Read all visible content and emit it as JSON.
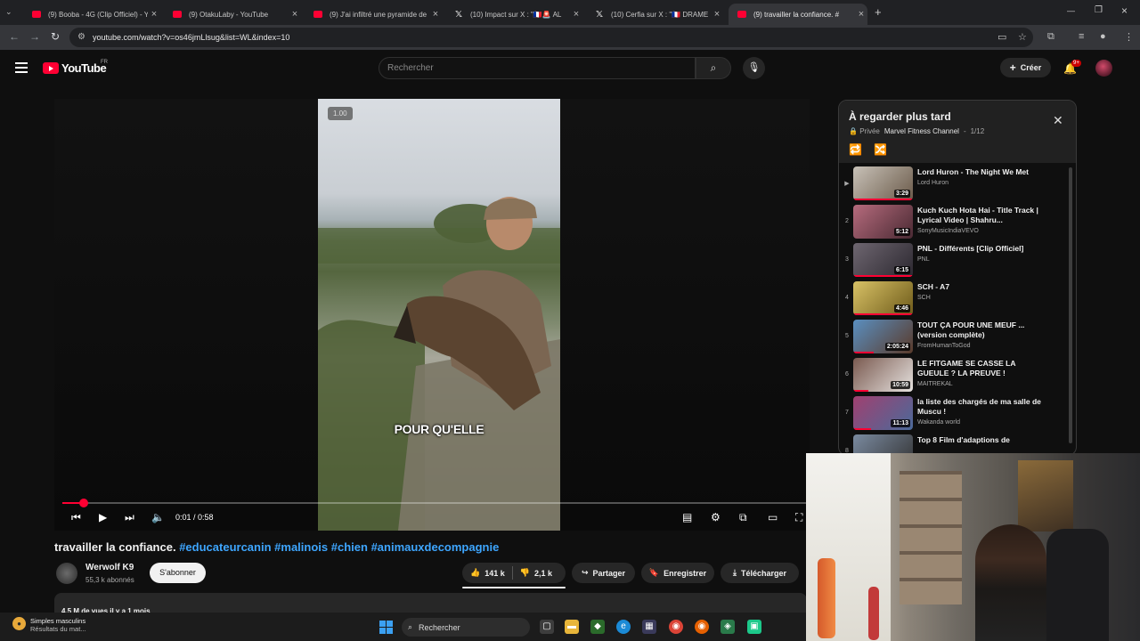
{
  "browser": {
    "tabs": [
      {
        "label": "(9) Booba - 4G (Clip Officiel) - Y",
        "favicon": "youtube-icon"
      },
      {
        "label": "(9) OtakuLaby - YouTube",
        "favicon": "youtube-icon"
      },
      {
        "label": "(9) J'ai infiltré une pyramide de",
        "favicon": "youtube-icon"
      },
      {
        "label": "(10) Impact sur X : \"🇫🇷🚨 AL",
        "favicon": "x-icon"
      },
      {
        "label": "(10) Cerfia sur X : \"🇫🇷 DRAME |",
        "favicon": "x-icon"
      },
      {
        "label": "(9) travailler la confiance. #",
        "favicon": "youtube-icon",
        "active": true
      }
    ],
    "url": "youtube.com/watch?v=os46jmLlsug&list=WL&index=10"
  },
  "header": {
    "logo_text": "YouTube",
    "country": "FR",
    "search_placeholder": "Rechercher",
    "create_label": "Créer",
    "notifications_badge": "9+"
  },
  "player": {
    "speed_badge": "1.00",
    "caption": "POUR QU'ELLE",
    "current_time": "0:01",
    "separator": " / ",
    "duration": "0:58",
    "progress_fraction": 0.029
  },
  "video": {
    "title": "travailler la confiance.",
    "hashtags": [
      "#educateurcanin",
      "#malinois",
      "#chien",
      "#animauxdecompagnie"
    ],
    "channel": "Werwolf K9",
    "subscribers": "55,3 k abonnés",
    "subscribe_label": "S'abonner",
    "likes": "141 k",
    "dislikes": "2,1 k",
    "share_label": "Partager",
    "save_label": "Enregistrer",
    "download_label": "Télécharger",
    "views_line": "4,5 M de vues  il y a 1 mois"
  },
  "playlist": {
    "title": "À regarder plus tard",
    "privacy": "Privée",
    "owner": "Marvel Fitness Channel",
    "position": "1/12",
    "items": [
      {
        "index": "▶",
        "title": "Lord Huron - The Night We Met",
        "channel": "Lord Huron",
        "duration": "3:29",
        "color_a": "#c8c2b8",
        "color_b": "#6b5a4a",
        "watched": 1.0
      },
      {
        "index": "2",
        "title": "Kuch Kuch Hota Hai - Title Track | Lyrical Video | Shahru...",
        "channel": "SonyMusicIndiaVEVO",
        "duration": "5:12",
        "color_a": "#b66b7d",
        "color_b": "#4a2a33",
        "watched": 0
      },
      {
        "index": "3",
        "title": "PNL - Différents [Clip Officiel]",
        "channel": "PNL",
        "duration": "6:15",
        "color_a": "#6e6670",
        "color_b": "#2c2830",
        "watched": 1.0
      },
      {
        "index": "4",
        "title": "SCH - A7",
        "channel": "SCH",
        "duration": "4:46",
        "color_a": "#d8c266",
        "color_b": "#6e5a1a",
        "watched": 1.0
      },
      {
        "index": "5",
        "title": "TOUT ÇA POUR UNE MEUF ... (version complète)",
        "channel": "FromHumanToGod",
        "duration": "2:05:24",
        "color_a": "#5a8fc0",
        "color_b": "#5a3a2a",
        "watched": 0.35
      },
      {
        "index": "6",
        "title": "LE FITGAME SE CASSE LA GUEULE ? LA PREUVE !",
        "channel": "MAITREKAL",
        "duration": "10:59",
        "color_a": "#7a5a50",
        "color_b": "#e6e2df",
        "watched": 0.25
      },
      {
        "index": "7",
        "title": "la liste des chargés de ma salle de Muscu !",
        "channel": "Wakanda world",
        "duration": "11:13",
        "color_a": "#a04070",
        "color_b": "#4a6a9a",
        "watched": 0.3
      },
      {
        "index": "8",
        "title": "Top 8 Film d'adaptions de",
        "channel": "",
        "duration": "",
        "color_a": "#7a8aa0",
        "color_b": "#333",
        "watched": 0
      }
    ]
  },
  "taskbar": {
    "notification_title": "Simples masculins",
    "notification_subtitle": "Résultats du mat...",
    "search_label": "Rechercher"
  },
  "colors": {
    "accent": "#ff0033",
    "link": "#3ea6ff",
    "background": "#0f0f0f"
  }
}
